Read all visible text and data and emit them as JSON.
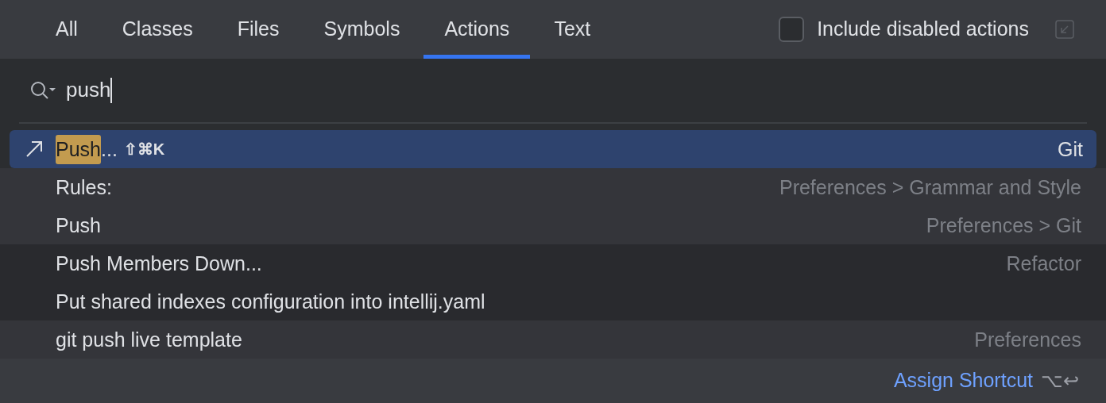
{
  "tabs": [
    {
      "label": "All",
      "selected": false
    },
    {
      "label": "Classes",
      "selected": false
    },
    {
      "label": "Files",
      "selected": false
    },
    {
      "label": "Symbols",
      "selected": false
    },
    {
      "label": "Actions",
      "selected": true
    },
    {
      "label": "Text",
      "selected": false
    }
  ],
  "include_disabled": {
    "label": "Include disabled actions",
    "checked": false
  },
  "search": {
    "value": "push"
  },
  "results": [
    {
      "match": "Push",
      "label": "...",
      "shortcut": "⇧⌘K",
      "location": "Git",
      "selected": true
    },
    {
      "label": "Rules:",
      "location": "Preferences > Grammar and Style",
      "selected": false,
      "shaded": false
    },
    {
      "label": "Push",
      "location": "Preferences > Git",
      "selected": false,
      "shaded": false
    },
    {
      "label": "Push Members Down...",
      "location": "Refactor",
      "selected": false,
      "shaded": true
    },
    {
      "label": "Put shared indexes configuration into intellij.yaml",
      "selected": false,
      "shaded": true
    },
    {
      "label": "git push live template",
      "location": "Preferences",
      "selected": false,
      "shaded": false
    }
  ],
  "footer": {
    "link": "Assign Shortcut",
    "shortcut": "⌥↩"
  }
}
